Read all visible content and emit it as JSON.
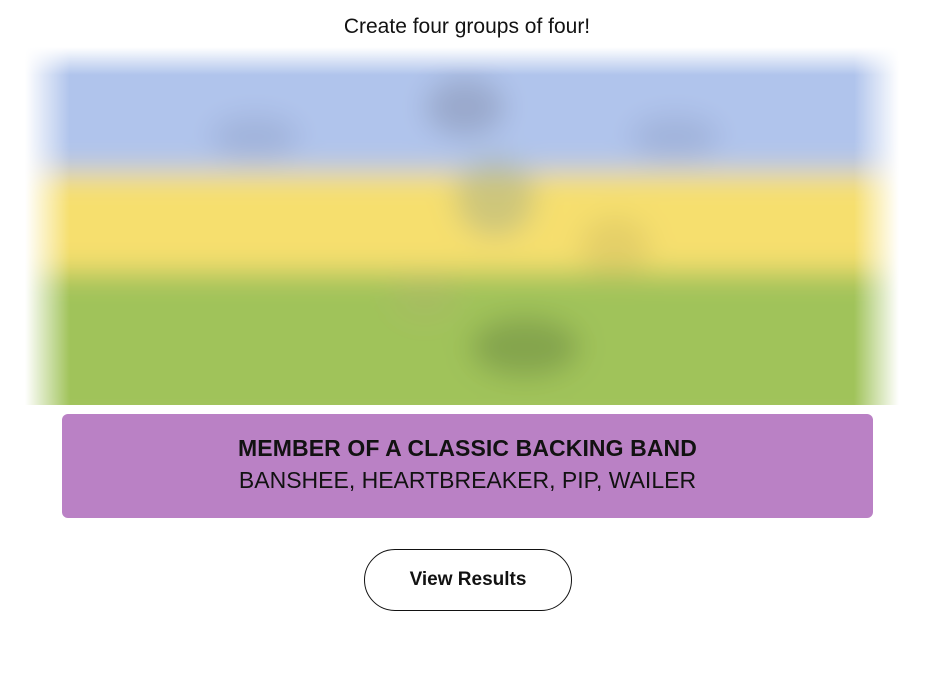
{
  "instruction": "Create four groups of four!",
  "solved_group": {
    "title": "MEMBER OF A CLASSIC BACKING BAND",
    "members": "BANSHEE, HEARTBREAKER, PIP, WAILER",
    "color": "#ba81c5"
  },
  "board_blur": {
    "colors": {
      "sky": "#b0c4ec",
      "yellow": "#f6df6e",
      "green": "#a0c35a"
    }
  },
  "view_results_label": "View Results"
}
